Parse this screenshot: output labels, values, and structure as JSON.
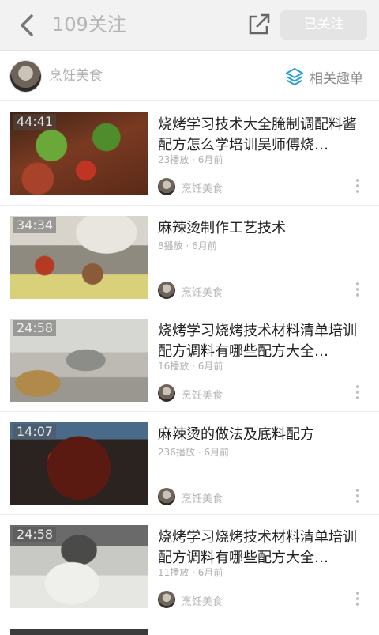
{
  "header": {
    "title": "109关注",
    "follow_button": "已关注",
    "back_icon": "back-arrow-icon",
    "share_icon": "share-icon"
  },
  "channel": {
    "name": "烹饪美食",
    "related_label": "相关趣单",
    "related_icon": "layers-icon",
    "accent_color": "#2a9fd6"
  },
  "videos": [
    {
      "duration": "44:41",
      "title": "烧烤学习技术大全腌制调配料酱配方怎么学培训吴师傅烧…",
      "plays": "23播放",
      "time": "6月前",
      "source": "烹饪美食"
    },
    {
      "duration": "34:34",
      "title": "麻辣烫制作工艺技术",
      "plays": "8播放",
      "time": "6月前",
      "source": "烹饪美食"
    },
    {
      "duration": "24:58",
      "title": "烧烤学习烧烤技术材料清单培训配方调料有哪些配方大全…",
      "plays": "16播放",
      "time": "6月前",
      "source": "烹饪美食"
    },
    {
      "duration": "14:07",
      "title": "麻辣烫的做法及底料配方",
      "plays": "236播放",
      "time": "6月前",
      "source": "烹饪美食"
    },
    {
      "duration": "24:58",
      "title": "烧烤学习烧烤技术材料清单培训配方调料有哪些配方大全…",
      "plays": "11播放",
      "time": "6月前",
      "source": "烹饪美食"
    }
  ]
}
